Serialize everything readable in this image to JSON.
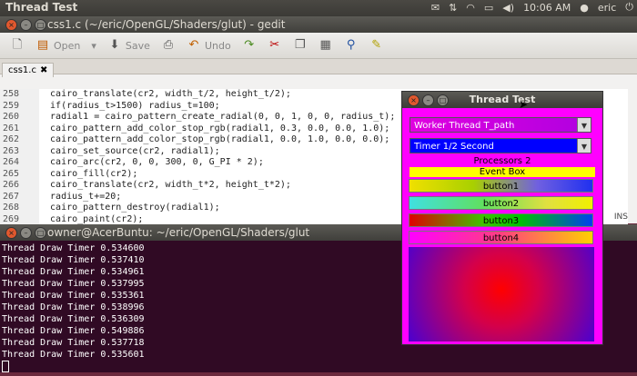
{
  "topbar": {
    "app_title": "Thread Test",
    "time": "10:06 AM",
    "user": "eric"
  },
  "gedit": {
    "title": "css1.c (~/eric/OpenGL/Shaders/glut) - gedit",
    "toolbar": {
      "open_label": "Open",
      "save_label": "Save",
      "undo_label": "Undo"
    },
    "tab_label": "css1.c",
    "status_ins": "INS",
    "lines": [
      {
        "num": "258",
        "text": "  cairo_translate(cr2, width_t/2, height_t/2);"
      },
      {
        "num": "259",
        "text": "  if(radius_t>1500) radius_t=100;"
      },
      {
        "num": "260",
        "text": "  radial1 = cairo_pattern_create_radial(0, 0, 1, 0, 0, radius_t);"
      },
      {
        "num": "261",
        "text": "  cairo_pattern_add_color_stop_rgb(radial1, 0.3, 0.0, 0.0, 1.0);"
      },
      {
        "num": "262",
        "text": "  cairo_pattern_add_color_stop_rgb(radial1, 0.0, 1.0, 0.0, 0.0);"
      },
      {
        "num": "263",
        "text": "  cairo_set_source(cr2, radial1);"
      },
      {
        "num": "264",
        "text": "  cairo_arc(cr2, 0, 0, 300, 0, G_PI * 2);"
      },
      {
        "num": "265",
        "text": "  cairo_fill(cr2);"
      },
      {
        "num": "266",
        "text": "  cairo_translate(cr2, width_t*2, height_t*2);"
      },
      {
        "num": "267",
        "text": "  radius_t+=20;"
      },
      {
        "num": "268",
        "text": "  cairo_pattern_destroy(radial1);"
      },
      {
        "num": "269",
        "text": "  cairo_paint(cr2);"
      }
    ]
  },
  "terminal": {
    "title": "owner@AcerBuntu: ~/eric/OpenGL/Shaders/glut",
    "lines": [
      "Thread Draw Timer 0.534600",
      "Thread Draw Timer 0.537410",
      "Thread Draw Timer 0.534961",
      "Thread Draw Timer 0.537995",
      "Thread Draw Timer 0.535361",
      "Thread Draw Timer 0.538996",
      "Thread Draw Timer 0.536309",
      "Thread Draw Timer 0.549886",
      "Thread Draw Timer 0.537718",
      "Thread Draw Timer 0.535601"
    ]
  },
  "thread_test": {
    "title": "Thread Test",
    "combo1": "Worker Thread T_path",
    "combo2": "Timer 1/2 Second",
    "processors": "Processors 2",
    "event_box": "Event Box",
    "buttons": [
      "button1",
      "button2",
      "button3",
      "button4"
    ]
  },
  "colors": {
    "window_bg": "#ff00ff",
    "event_box": "#ffff00",
    "terminal_bg": "#300a24"
  }
}
